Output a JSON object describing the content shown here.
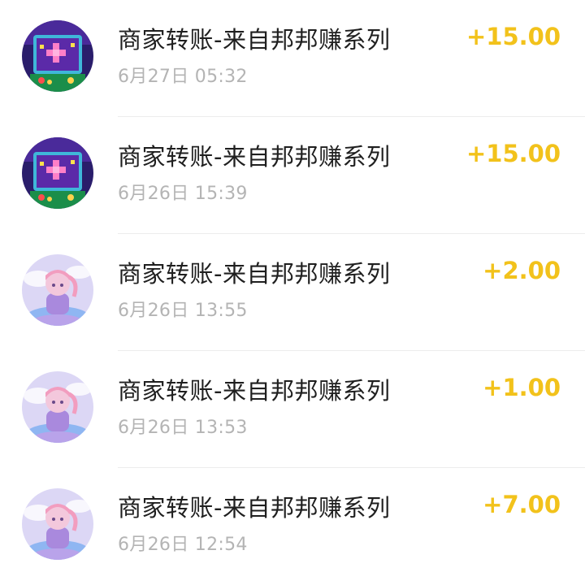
{
  "transactions": [
    {
      "title": "商家转账-来自邦邦赚系列",
      "time": "6月27日 05:32",
      "amount": "+15.00",
      "avatar": "arcade-avatar"
    },
    {
      "title": "商家转账-来自邦邦赚系列",
      "time": "6月26日 15:39",
      "amount": "+15.00",
      "avatar": "arcade-avatar"
    },
    {
      "title": "商家转账-来自邦邦赚系列",
      "time": "6月26日 13:55",
      "amount": "+2.00",
      "avatar": "anime-girl-avatar"
    },
    {
      "title": "商家转账-来自邦邦赚系列",
      "time": "6月26日 13:53",
      "amount": "+1.00",
      "avatar": "anime-girl-avatar"
    },
    {
      "title": "商家转账-来自邦邦赚系列",
      "time": "6月26日 12:54",
      "amount": "+7.00",
      "avatar": "anime-girl-avatar"
    }
  ],
  "colors": {
    "amount": "#f2c21b",
    "title": "#1f1f1f",
    "time": "#b4b4b4",
    "divider": "#ececec"
  }
}
